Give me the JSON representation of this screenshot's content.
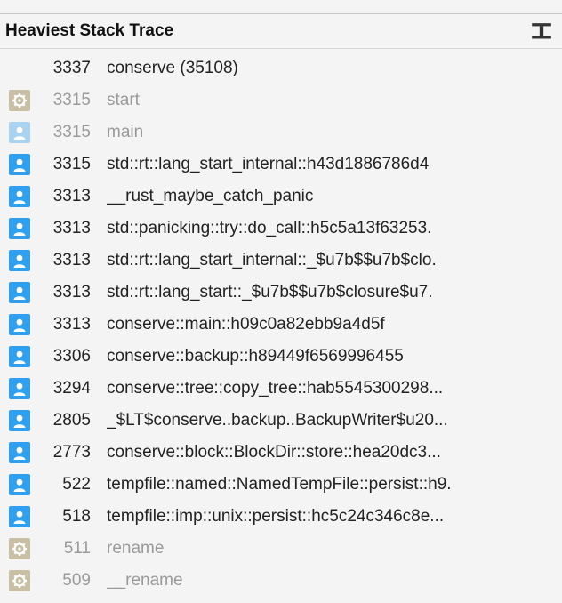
{
  "header": {
    "title": "Heaviest Stack Trace"
  },
  "rows": [
    {
      "icon": "none",
      "muted": false,
      "count": "3337",
      "symbol": "conserve (35108)"
    },
    {
      "icon": "gear",
      "muted": true,
      "count": "3315",
      "symbol": "start"
    },
    {
      "icon": "user",
      "muted": true,
      "count": "3315",
      "symbol": "main"
    },
    {
      "icon": "user",
      "muted": false,
      "count": "3315",
      "symbol": "std::rt::lang_start_internal::h43d1886786d4"
    },
    {
      "icon": "user",
      "muted": false,
      "count": "3313",
      "symbol": "__rust_maybe_catch_panic"
    },
    {
      "icon": "user",
      "muted": false,
      "count": "3313",
      "symbol": "std::panicking::try::do_call::h5c5a13f63253."
    },
    {
      "icon": "user",
      "muted": false,
      "count": "3313",
      "symbol": "std::rt::lang_start_internal::_$u7b$$u7b$clo."
    },
    {
      "icon": "user",
      "muted": false,
      "count": "3313",
      "symbol": "std::rt::lang_start::_$u7b$$u7b$closure$u7."
    },
    {
      "icon": "user",
      "muted": false,
      "count": "3313",
      "symbol": "conserve::main::h09c0a82ebb9a4d5f"
    },
    {
      "icon": "user",
      "muted": false,
      "count": "3306",
      "symbol": "conserve::backup::h89449f6569996455"
    },
    {
      "icon": "user",
      "muted": false,
      "count": "3294",
      "symbol": "conserve::tree::copy_tree::hab5545300298..."
    },
    {
      "icon": "user",
      "muted": false,
      "count": "2805",
      "symbol": "_$LT$conserve..backup..BackupWriter$u20..."
    },
    {
      "icon": "user",
      "muted": false,
      "count": "2773",
      "symbol": "conserve::block::BlockDir::store::hea20dc3..."
    },
    {
      "icon": "user",
      "muted": false,
      "count": "522",
      "symbol": "tempfile::named::NamedTempFile::persist::h9."
    },
    {
      "icon": "user",
      "muted": false,
      "count": "518",
      "symbol": "tempfile::imp::unix::persist::hc5c24c346c8e..."
    },
    {
      "icon": "gear",
      "muted": true,
      "count": "511",
      "symbol": "rename"
    },
    {
      "icon": "gear",
      "muted": true,
      "count": "509",
      "symbol": "__rename"
    }
  ]
}
